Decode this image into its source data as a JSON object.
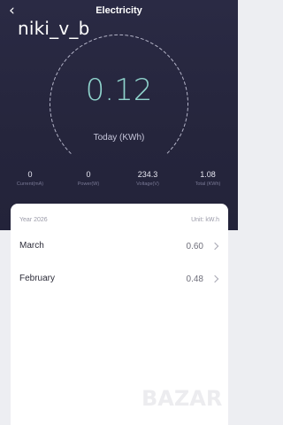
{
  "header": {
    "title": "Electricity",
    "back_icon": "chevron-left-icon"
  },
  "watermark": "niki_v_b",
  "gauge": {
    "value": "0.12",
    "unit_label": "Today (KWh)"
  },
  "stats": [
    {
      "value": "0",
      "label": "Current(mA)"
    },
    {
      "value": "0",
      "label": "Power(W)"
    },
    {
      "value": "234.3",
      "label": "Voltage(V)"
    },
    {
      "value": "1.08",
      "label": "Total (KWh)"
    }
  ],
  "card": {
    "year": "Year 2026",
    "unit": "Unit: kW.h",
    "rows": [
      {
        "month": "March",
        "value": "0.60"
      },
      {
        "month": "February",
        "value": "0.48"
      }
    ]
  },
  "logo_text": "BAZAR",
  "colors": {
    "accent": "#8fd3cc",
    "dark_bg": "#26263e",
    "light_bg": "#edeef2"
  }
}
